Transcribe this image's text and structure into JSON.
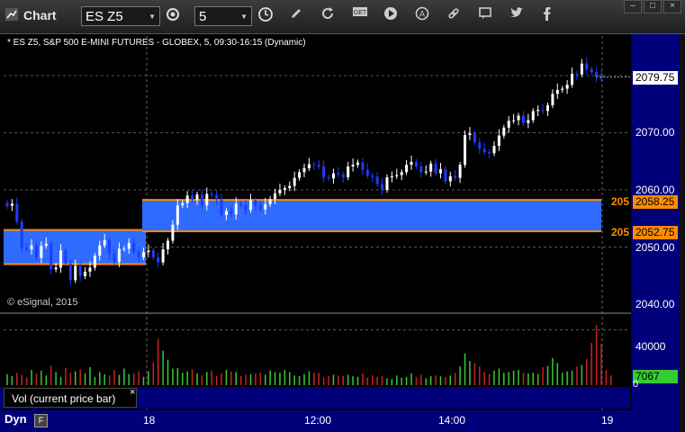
{
  "window": {
    "title": "Chart"
  },
  "toolbar": {
    "symbol": "ES Z5",
    "interval": "5",
    "icons": [
      "settings-icon",
      "clock-icon",
      "pencil-icon",
      "refresh-icon",
      "get-icon",
      "play-icon",
      "alert-icon",
      "link-icon",
      "comment-icon",
      "twitter-icon",
      "facebook-icon"
    ],
    "window_buttons": [
      "min",
      "max",
      "close"
    ]
  },
  "chart": {
    "title": "* ES Z5, S&P 500 E-MINI FUTURES - GLOBEX, 5, 09:30-16:15 (Dynamic)",
    "watermark": "© eSignal, 2015",
    "y_ticks": [
      "2080.00",
      "2070.00",
      "2060.00",
      "2050.00",
      "2040.00"
    ],
    "last_price": "2079.75",
    "zone_upper_price": "2058.25",
    "zone_lower_price": "2052.75",
    "zone_upper_cut": "205",
    "zone_lower_cut": "205",
    "time_ticks": [
      "18",
      "12:00",
      "14:00",
      "19"
    ],
    "volume_tick": "40000",
    "volume_last": "7067",
    "volume_zero": "0",
    "volume_label": "Vol (current price bar)",
    "volume_close": "×",
    "dyn_label": "Dyn",
    "dyn_box": "F"
  },
  "colors": {
    "zone": "#2f6bff",
    "zone_border": "#ff8c00",
    "up": "#ffffff",
    "down": "#1f3bff",
    "vol_up": "#33cc33",
    "vol_down": "#cc2222",
    "axis_bg": "#00007a"
  },
  "chart_data": {
    "type": "candlestick",
    "price_axis": {
      "min": 2040,
      "max": 2084
    },
    "volume_axis": {
      "min": 0,
      "max": 52000
    },
    "close": [
      2057.2,
      2057.6,
      2054.4,
      2049.9,
      2049.6,
      2050.3,
      2048.1,
      2050.2,
      2050.6,
      2046.1,
      2046.4,
      2049.4,
      2047.1,
      2044.2,
      2046.7,
      2044.9,
      2045.7,
      2046.4,
      2048.5,
      2050.3,
      2051.2,
      2048.8,
      2047.4,
      2049.7,
      2049.7,
      2050.7,
      2049.2,
      2048.2,
      2049.1,
      2049.4,
      2048.2,
      2047.3,
      2049.6,
      2051.1,
      2053.9,
      2057.3,
      2057.7,
      2059.0,
      2058.3,
      2059.2,
      2057.3,
      2059.3,
      2059.1,
      2058.3,
      2055.6,
      2056.3,
      2055.7,
      2057.6,
      2057.4,
      2056.5,
      2058.2,
      2057.3,
      2056.6,
      2057.5,
      2058.4,
      2059.4,
      2060.0,
      2060.3,
      2060.7,
      2062.1,
      2063.1,
      2063.8,
      2064.5,
      2064.4,
      2064.1,
      2062.2,
      2062.0,
      2062.9,
      2062.7,
      2062.2,
      2064.1,
      2064.4,
      2064.8,
      2063.5,
      2062.5,
      2062.3,
      2061.0,
      2060.0,
      2062.2,
      2062.4,
      2062.6,
      2063.1,
      2064.4,
      2064.9,
      2064.1,
      2063.1,
      2063.2,
      2064.6,
      2062.9,
      2063.6,
      2061.5,
      2062.4,
      2062.1,
      2064.4,
      2069.6,
      2069.9,
      2068.3,
      2067.2,
      2066.6,
      2066.4,
      2067.7,
      2069.5,
      2070.9,
      2072.1,
      2072.2,
      2073.0,
      2071.7,
      2072.2,
      2073.8,
      2074.0,
      2073.8,
      2074.8,
      2076.8,
      2077.5,
      2077.7,
      2078.4,
      2080.3,
      2080.2,
      2082.1,
      2081.1,
      2080.6,
      2079.8,
      2079.5
    ],
    "volume": [
      8000,
      6500,
      9000,
      7500,
      5500,
      11000,
      8500,
      10500,
      7000,
      14000,
      9500,
      6000,
      12500,
      9000,
      10000,
      11500,
      8500,
      13000,
      6000,
      9500,
      8000,
      7000,
      11000,
      7500,
      12000,
      8000,
      8500,
      10000,
      6000,
      10000,
      16500,
      33500,
      25000,
      18500,
      12000,
      12500,
      9000,
      10000,
      11500,
      8500,
      7000,
      9500,
      10500,
      6500,
      8500,
      11000,
      10000,
      9500,
      6500,
      7500,
      8000,
      8500,
      9000,
      7500,
      10500,
      9500,
      9000,
      11000,
      9500,
      7000,
      6500,
      8000,
      10000,
      9000,
      9000,
      5500,
      6500,
      7500,
      7000,
      6500,
      7500,
      6500,
      6000,
      8500,
      5500,
      7000,
      6000,
      6500,
      5000,
      4500,
      7000,
      5500,
      6000,
      8500,
      6000,
      7500,
      5000,
      6500,
      7000,
      6500,
      6000,
      7000,
      9000,
      13500,
      23000,
      17500,
      16000,
      13500,
      9500,
      8000,
      10500,
      12000,
      9000,
      9500,
      10500,
      11000,
      9000,
      8500,
      9000,
      8000,
      13000,
      14000,
      19500,
      16000,
      9000,
      10000,
      10500,
      13500,
      14500,
      19000,
      30500,
      43500,
      30000,
      11000,
      7067
    ],
    "zone_upper": 2058.25,
    "zone_lower": 2052.75,
    "zone_prev_upper": 2053.0,
    "zone_prev_lower": 2047.0,
    "last": 2079.75,
    "volume_last": 7067
  }
}
